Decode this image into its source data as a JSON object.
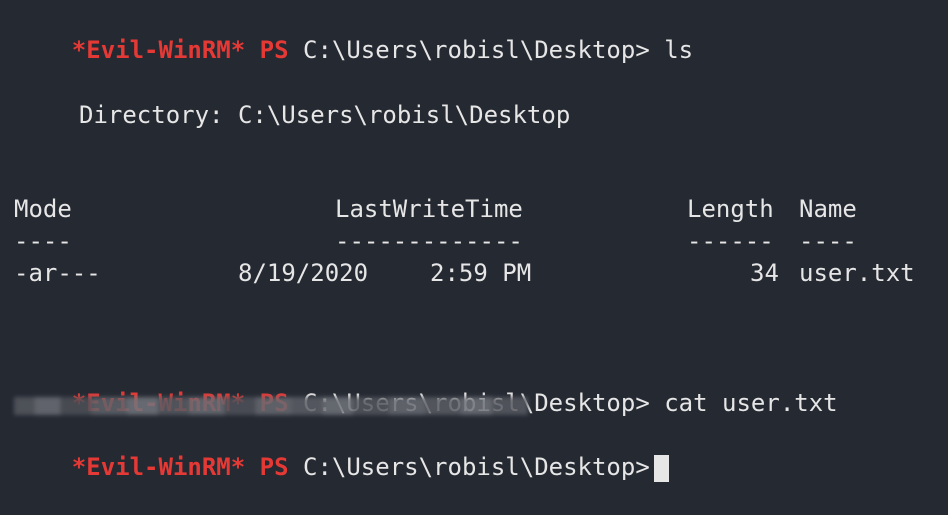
{
  "terminal": {
    "prompt": {
      "evil": "*Evil-WinRM*",
      "ps": "PS",
      "path": "C:\\Users\\robisl\\Desktop>"
    },
    "line1_command": "ls",
    "directory_line": "Directory: C:\\Users\\robisl\\Desktop",
    "listing": {
      "headers": {
        "mode": "Mode",
        "lastwritetime": "LastWriteTime",
        "length": "Length",
        "name": "Name"
      },
      "underlines": {
        "mode": "----",
        "lastwritetime": "-------------",
        "length": "------",
        "name": "----"
      },
      "rows": [
        {
          "mode": "-ar---",
          "date": "8/19/2020",
          "time": "2:59 PM",
          "length": "34",
          "name": "user.txt"
        }
      ]
    },
    "line2_command": "cat user.txt",
    "colors": {
      "background": "#252932",
      "prompt_red": "#e53935",
      "text": "#e6e6e6"
    }
  }
}
